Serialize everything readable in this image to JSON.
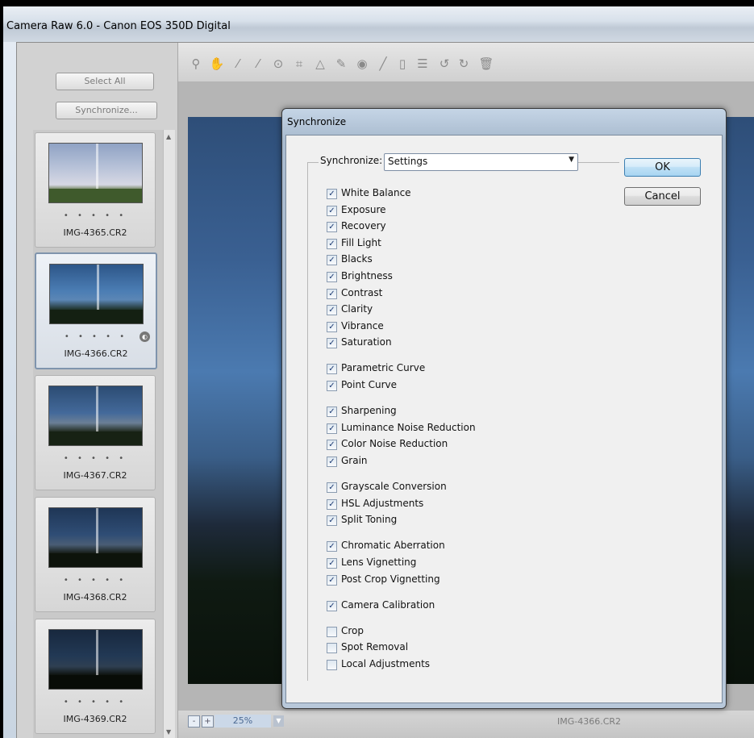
{
  "window": {
    "title": "Camera Raw 6.0  -  Canon EOS 350D Digital"
  },
  "left_panel": {
    "select_all_label": "Select All",
    "synchronize_label": "Synchronize...",
    "thumbnails": [
      {
        "name": "IMG-4365.CR2",
        "stars": "• • • • •",
        "selected": false
      },
      {
        "name": "IMG-4366.CR2",
        "stars": "• • • • •",
        "selected": true
      },
      {
        "name": "IMG-4367.CR2",
        "stars": "• • • • •",
        "selected": false
      },
      {
        "name": "IMG-4368.CR2",
        "stars": "• • • • •",
        "selected": false
      },
      {
        "name": "IMG-4369.CR2",
        "stars": "• • • • •",
        "selected": false
      }
    ]
  },
  "toolbar": {
    "tools": [
      "zoom-icon",
      "hand-icon",
      "white-balance-icon",
      "color-sampler-icon",
      "targeted-adjustment-icon",
      "crop-icon",
      "straighten-icon",
      "spot-removal-icon",
      "red-eye-icon",
      "adjustment-brush-icon",
      "graduated-filter-icon",
      "preferences-icon",
      "rotate-ccw-icon",
      "rotate-cw-icon",
      "trash-icon"
    ]
  },
  "status_bar": {
    "zoom_minus": "-",
    "zoom_plus": "+",
    "zoom_value": "25%",
    "filename": "IMG-4366.CR2"
  },
  "dialog": {
    "title": "Synchronize",
    "synchronize_label": "Synchronize:",
    "synchronize_value": "Settings",
    "ok_label": "OK",
    "cancel_label": "Cancel",
    "options": [
      {
        "label": "White Balance",
        "checked": true
      },
      {
        "label": "Exposure",
        "checked": true
      },
      {
        "label": "Recovery",
        "checked": true
      },
      {
        "label": "Fill Light",
        "checked": true
      },
      {
        "label": "Blacks",
        "checked": true
      },
      {
        "label": "Brightness",
        "checked": true
      },
      {
        "label": "Contrast",
        "checked": true
      },
      {
        "label": "Clarity",
        "checked": true
      },
      {
        "label": "Vibrance",
        "checked": true
      },
      {
        "label": "Saturation",
        "checked": true
      },
      {
        "label": "Parametric Curve",
        "checked": true
      },
      {
        "label": "Point Curve",
        "checked": true
      },
      {
        "label": "Sharpening",
        "checked": true
      },
      {
        "label": "Luminance Noise Reduction",
        "checked": true
      },
      {
        "label": "Color Noise Reduction",
        "checked": true
      },
      {
        "label": "Grain",
        "checked": true
      },
      {
        "label": "Grayscale Conversion",
        "checked": true
      },
      {
        "label": "HSL Adjustments",
        "checked": true
      },
      {
        "label": "Split Toning",
        "checked": true
      },
      {
        "label": "Chromatic Aberration",
        "checked": true
      },
      {
        "label": "Lens Vignetting",
        "checked": true
      },
      {
        "label": "Post Crop Vignetting",
        "checked": true
      },
      {
        "label": "Camera Calibration",
        "checked": true
      },
      {
        "label": "Crop",
        "checked": false
      },
      {
        "label": "Spot Removal",
        "checked": false
      },
      {
        "label": "Local Adjustments",
        "checked": false
      }
    ]
  }
}
